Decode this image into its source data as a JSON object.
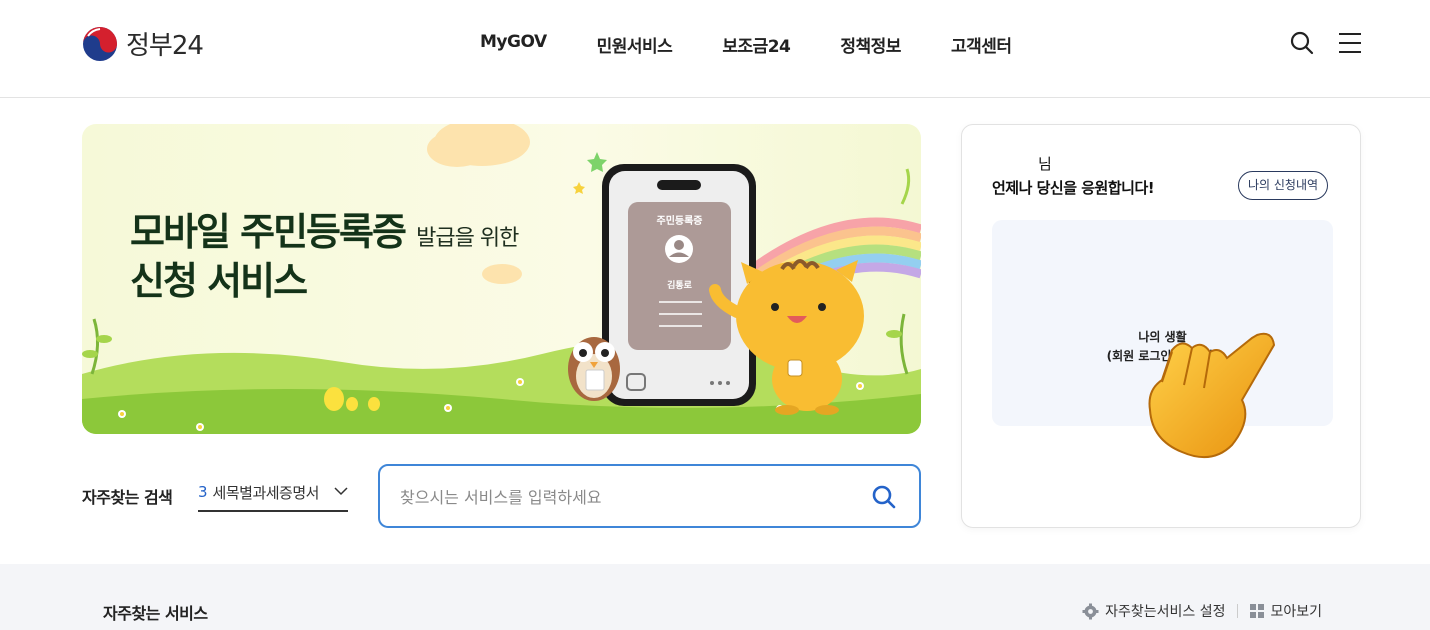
{
  "header": {
    "logo_text": "정부24",
    "nav": [
      "MyGOV",
      "민원서비스",
      "보조금24",
      "정책정보",
      "고객센터"
    ]
  },
  "banner": {
    "title_line1": "모바일 주민등록증",
    "title_small": "발급을 위한",
    "title_line2": "신청 서비스",
    "card_title": "주민등록증",
    "card_name": "김통로"
  },
  "side": {
    "greeting_name": "님",
    "greeting_msg": "언제나 당신을 응원합니다!",
    "my_apps_label": "나의 신청내역",
    "info_line1": "나의 생활",
    "info_line2": "(회원 로그인 후 확인)"
  },
  "search": {
    "freq_label": "자주찾는 검색",
    "rank_num": "3",
    "rank_text": "세목별과세증명서",
    "placeholder": "찾으시는 서비스를 입력하세요"
  },
  "bottom": {
    "title": "자주찾는 서비스",
    "settings_label": "자주찾는서비스 설정",
    "collect_label": "모아보기"
  },
  "colors": {
    "accent_blue": "#3f86d8",
    "navy": "#2a3a5e",
    "banner_bg": "#f6f9d8"
  }
}
